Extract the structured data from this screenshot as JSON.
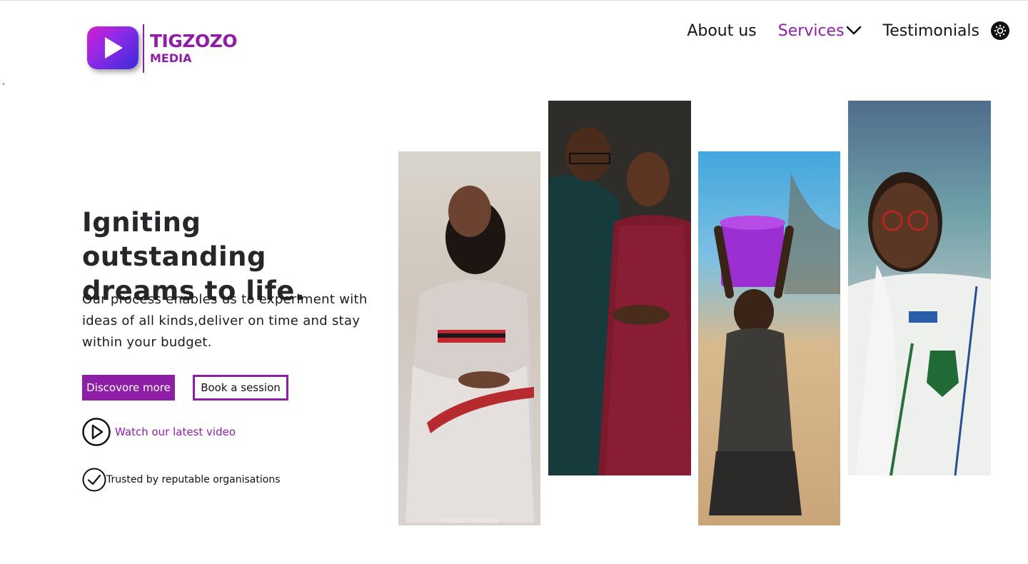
{
  "header": {
    "logo": {
      "word1": "TIGZOZO",
      "word2": "MEDIA",
      "icon": "play-logo-icon"
    },
    "nav": {
      "about": "About us",
      "services": "Services",
      "testimonials": "Testimonials"
    },
    "theme_toggle_icon": "sun-icon"
  },
  "stray_mark": "`",
  "hero": {
    "headline": "Igniting outstanding dreams to life.",
    "subtext": "Our process enables us to experiment with ideas of all kinds,deliver on time and stay within your budget.",
    "primary_button": "Discovore more",
    "secondary_button": "Book a session",
    "video_link": "Watch our latest video",
    "trusted_text": "Trusted by reputable organisations"
  },
  "gallery": {
    "photos": [
      {
        "subject": "bride-portrait",
        "watermark": "TIGZOZO STUDIOS"
      },
      {
        "subject": "couple-portrait"
      },
      {
        "subject": "child-with-bucket"
      },
      {
        "subject": "student-portrait"
      }
    ]
  },
  "colors": {
    "brand": "#8e1ea6",
    "text": "#26272b",
    "background": "#ffffff"
  }
}
